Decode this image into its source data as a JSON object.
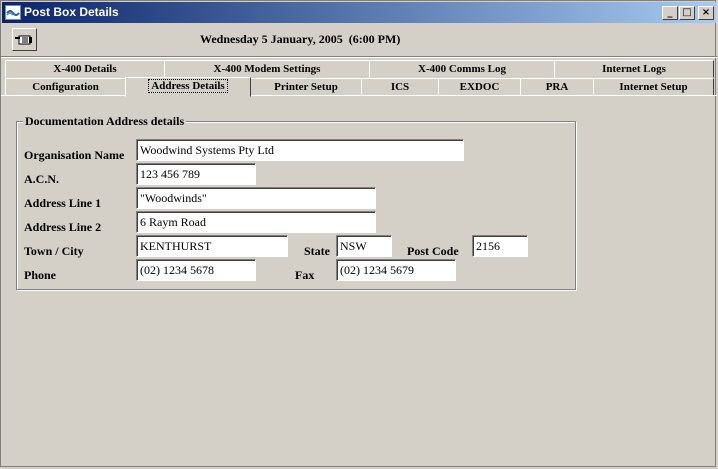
{
  "window": {
    "title": "Post Box Details",
    "controls": {
      "minimize": "_",
      "maximize": "□",
      "close": "×"
    }
  },
  "toolbar": {
    "datetime": "Wednesday 5 January, 2005  (6:00 PM)",
    "button_icon": "hand-point-icon"
  },
  "tabs": {
    "row1": [
      "X-400 Details",
      "X-400 Modem Settings",
      "X-400 Comms Log",
      "Internet Logs"
    ],
    "row2": [
      "Configuration",
      "Address Details",
      "Printer Setup",
      "ICS",
      "EXDOC",
      "PRA",
      "Internet Setup"
    ],
    "active": "Address Details"
  },
  "group": {
    "title": "Documentation Address details",
    "labels": {
      "organisation": "Organisation Name",
      "acn": "A.C.N.",
      "address1": "Address Line 1",
      "address2": "Address Line 2",
      "town": "Town / City",
      "state": "State",
      "postcode": "Post Code",
      "phone": "Phone",
      "fax": "Fax"
    },
    "values": {
      "organisation": "Woodwind Systems Pty Ltd",
      "acn": "123 456 789",
      "address1": "\"Woodwinds\"",
      "address2": "6 Raym Road",
      "town": "KENTHURST",
      "state": "NSW",
      "postcode": "2156",
      "phone": "(02) 1234 5678",
      "fax": "(02) 1234 5679"
    }
  }
}
